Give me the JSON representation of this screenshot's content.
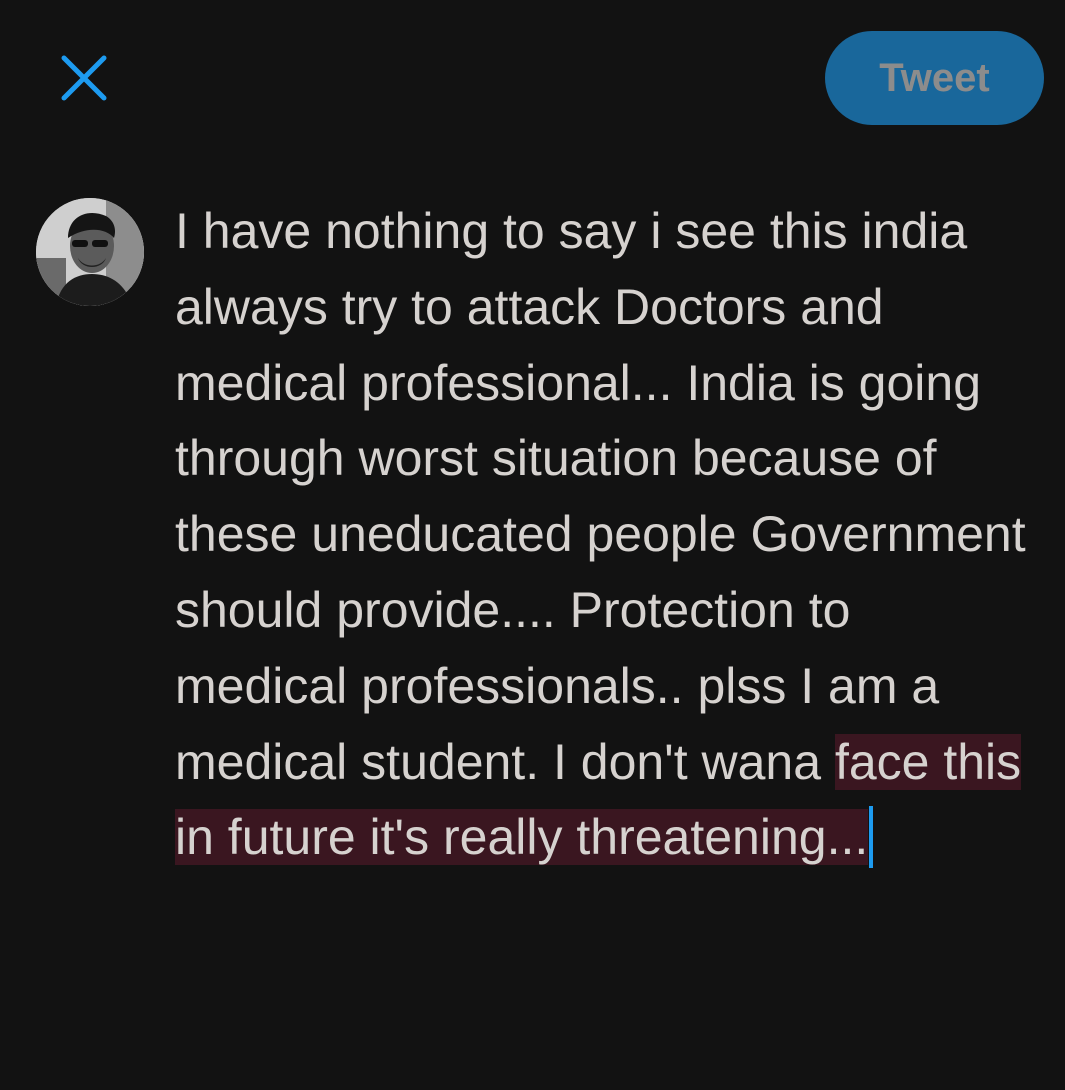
{
  "header": {
    "close_icon": "close-icon",
    "tweet_label": "Tweet"
  },
  "colors": {
    "background": "#121212",
    "accent": "#1d9bf0",
    "tweet_button": "#19679b",
    "overflow_highlight": "#3a1620",
    "text": "#d6d2cf"
  },
  "composer": {
    "avatar_icon": "user-avatar",
    "text_main": "I have nothing to say i see this india always try to attack Doctors and medical professional... India is going through worst situation because of these uneducated people Government should provide.... Protection to medical professionals.. plss I am a medical student. I don't wana ",
    "text_overflow": "face this in future it's really threatening..."
  }
}
